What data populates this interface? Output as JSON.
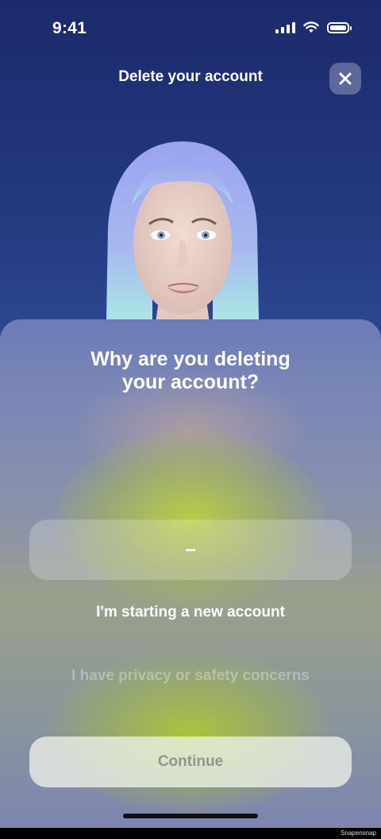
{
  "status_bar": {
    "time": "9:41"
  },
  "header": {
    "title": "Delete your account"
  },
  "question": {
    "line1": "Why are you deleting",
    "line2": "your account?"
  },
  "picker": {
    "selected": "–",
    "options": [
      "I'm starting a new account",
      "I have privacy or safety concerns"
    ]
  },
  "continue_label": "Continue",
  "watermark": "Snapensnap"
}
